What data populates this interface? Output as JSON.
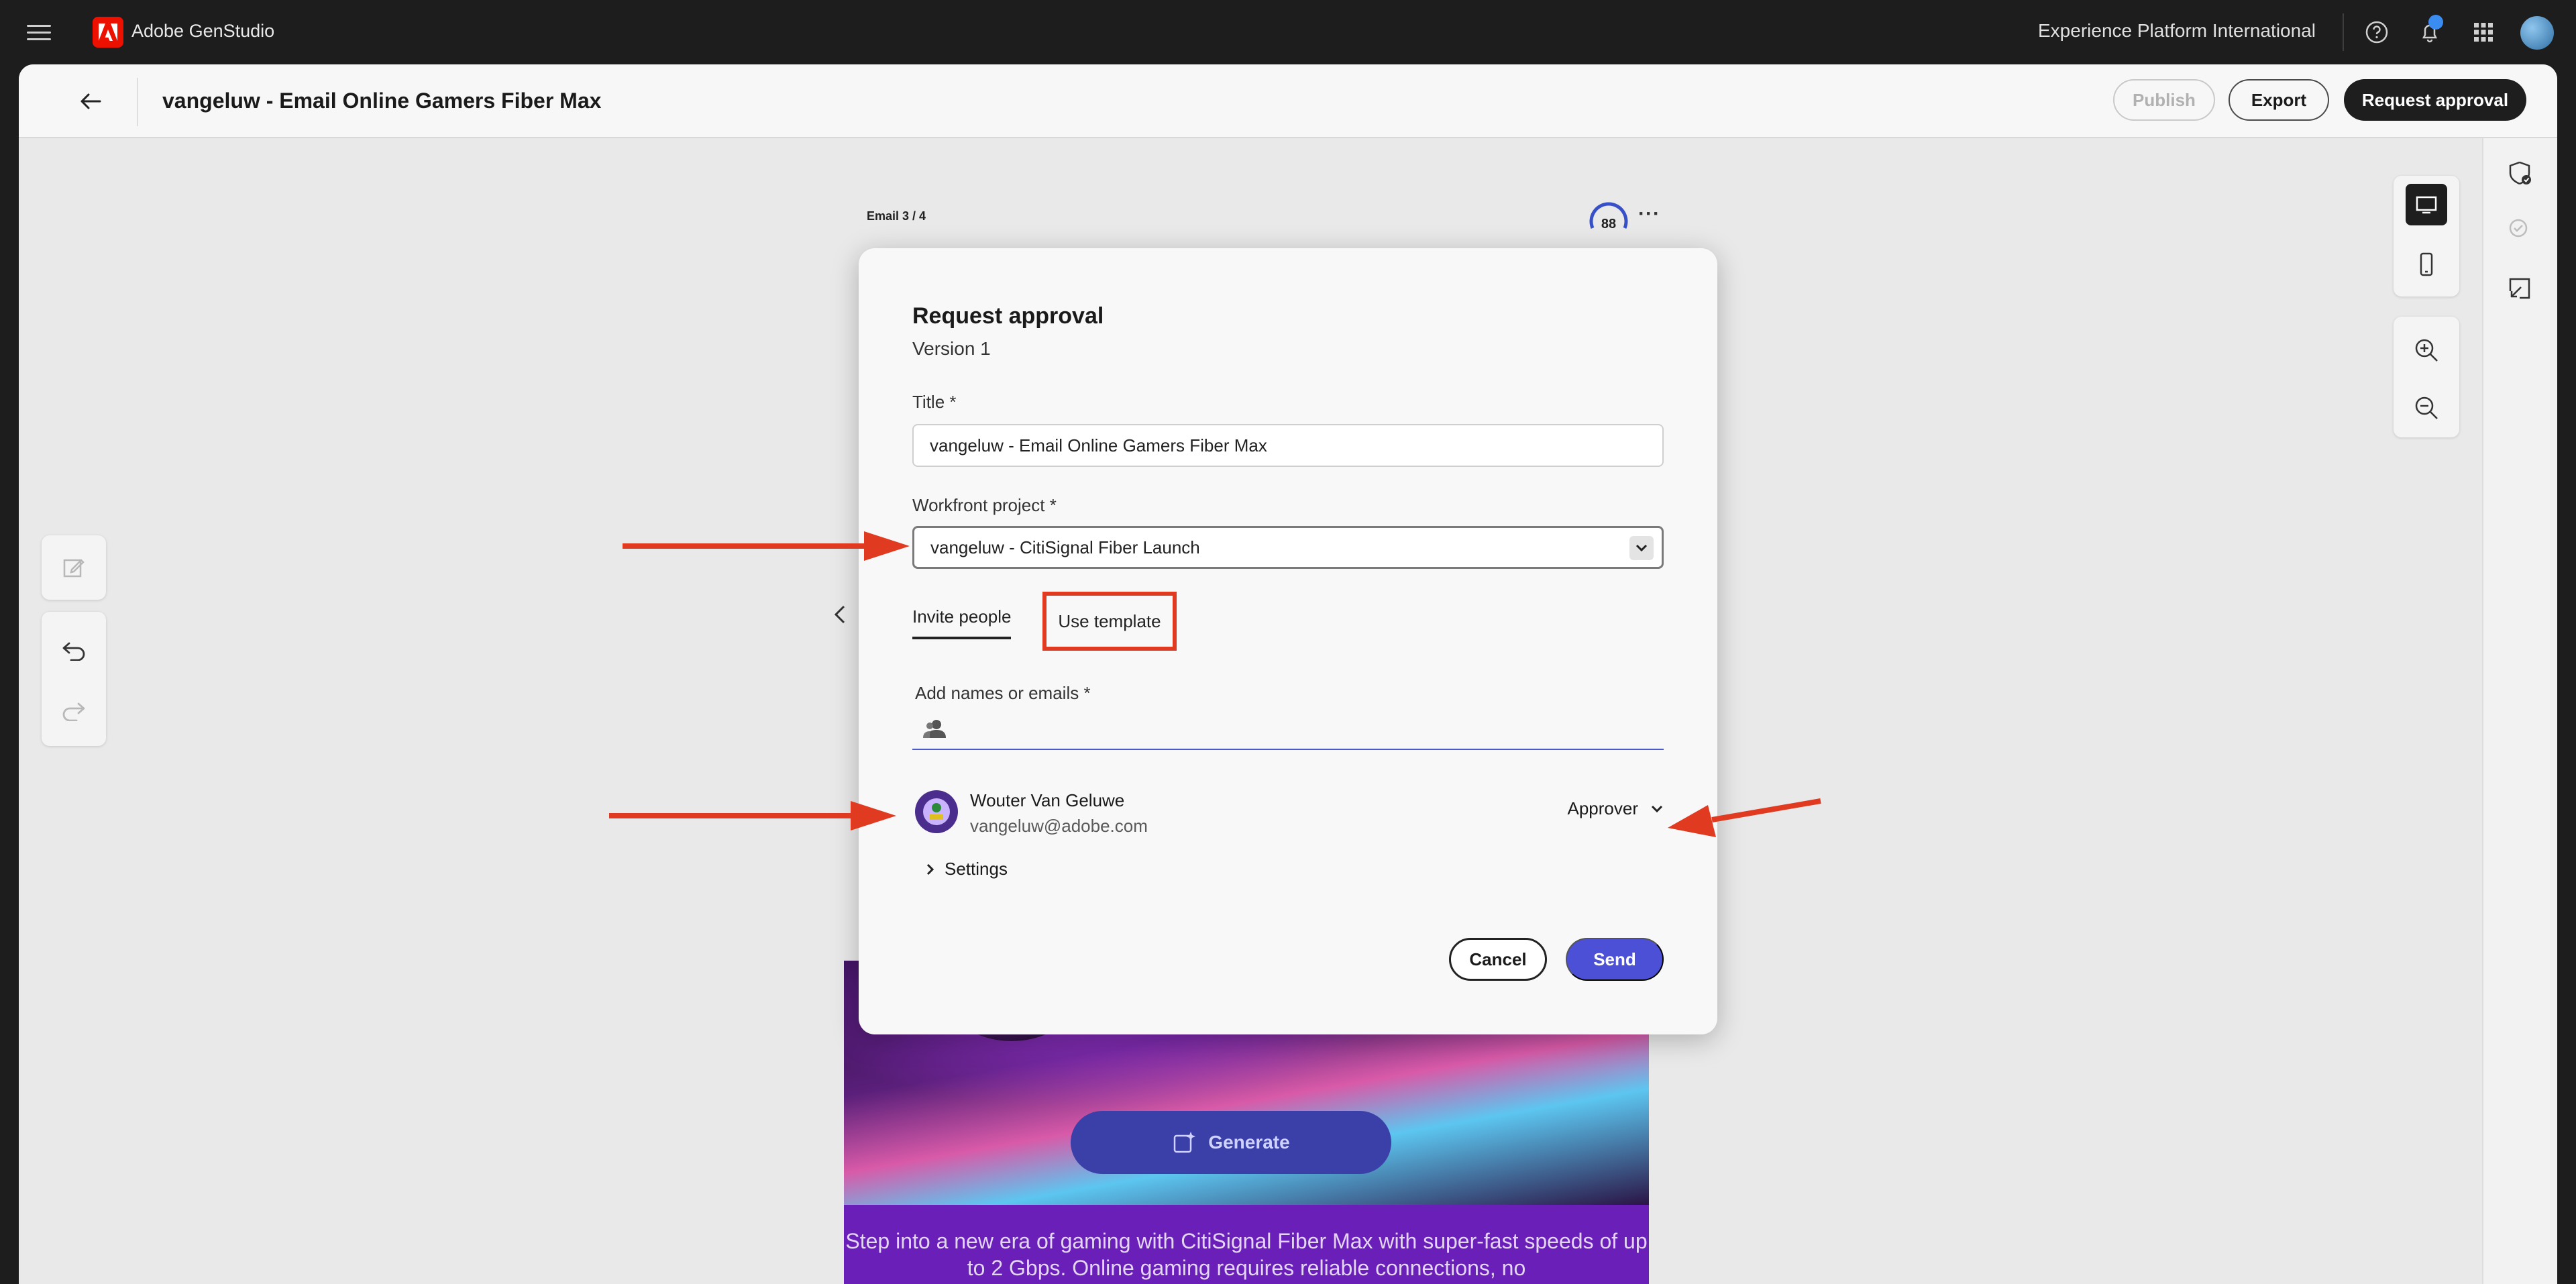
{
  "topbar": {
    "app_name": "Adobe GenStudio",
    "org_name": "Experience Platform International"
  },
  "header": {
    "title": "vangeluw - Email Online Gamers Fiber Max",
    "publish_label": "Publish",
    "export_label": "Export",
    "request_approval_label": "Request approval"
  },
  "canvas": {
    "email_counter": "Email 3 / 4",
    "score": "88",
    "generate_label": "Generate",
    "body_text": "Step into a new era of gaming with CitiSignal Fiber Max with super-fast speeds of up to 2 Gbps. Online gaming requires reliable connections, no"
  },
  "modal": {
    "title": "Request approval",
    "version": "Version 1",
    "title_label": "Title *",
    "title_value": "vangeluw - Email Online Gamers Fiber Max",
    "project_label": "Workfront project  *",
    "project_value": "vangeluw - CitiSignal Fiber Launch",
    "tabs": [
      {
        "label": "Invite people"
      },
      {
        "label": "Use template"
      }
    ],
    "names_label": "Add names or emails *",
    "invitee": {
      "name": "Wouter Van Geluwe",
      "email": "vangeluw@adobe.com",
      "role": "Approver"
    },
    "settings_label": "Settings",
    "cancel_label": "Cancel",
    "send_label": "Send"
  },
  "colors": {
    "accent_blue": "#4b50d6",
    "annotation_red": "#e03a20",
    "adobe_red": "#eb1000"
  }
}
